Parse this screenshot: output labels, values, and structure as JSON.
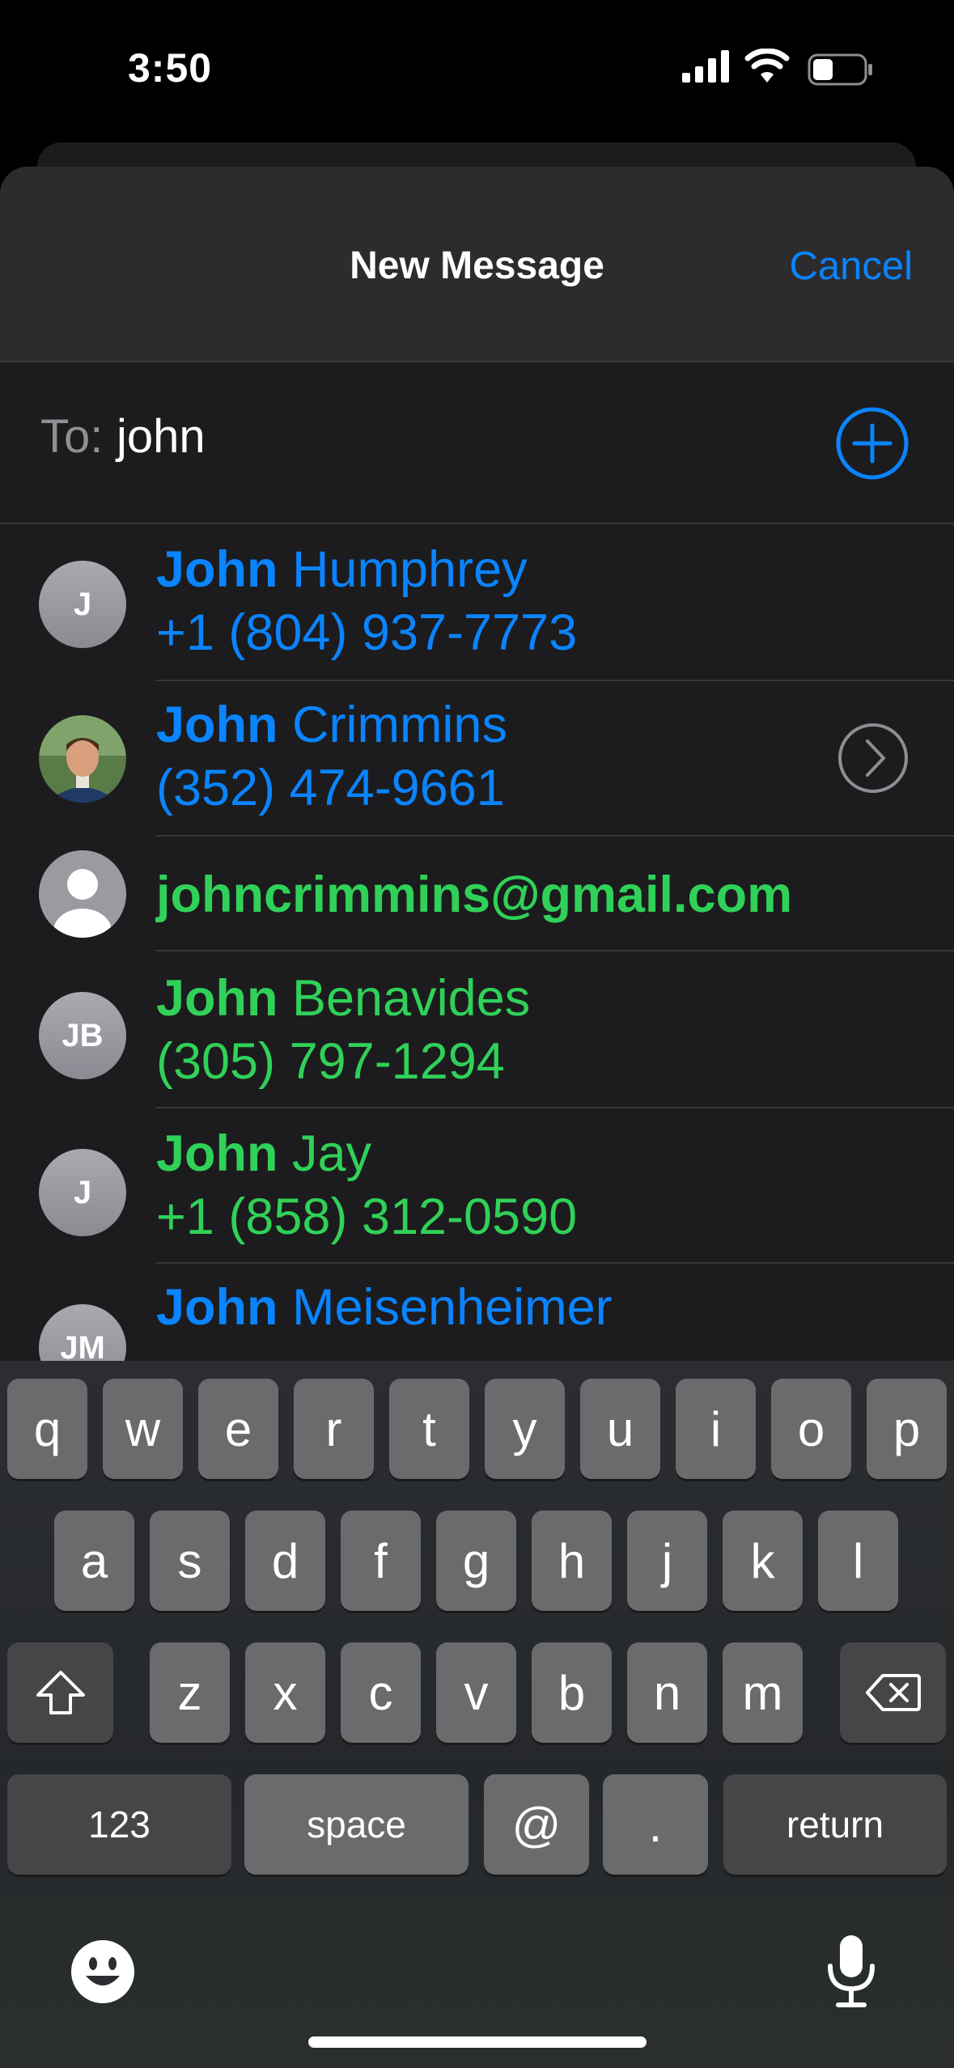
{
  "status_bar": {
    "time": "3:50"
  },
  "header": {
    "title": "New Message",
    "cancel_label": "Cancel"
  },
  "to_field": {
    "label": "To:",
    "value": "john"
  },
  "suggestions": [
    {
      "avatar_initials": "J",
      "first": "John",
      "last": " Humphrey",
      "detail": "+1 (804) 937-7773",
      "color": "#0a84ff"
    },
    {
      "avatar_type": "photo",
      "first": "John",
      "last": " Crimmins",
      "detail": "(352) 474-9661",
      "color": "#0a84ff"
    },
    {
      "avatar_type": "person-icon",
      "email": "johncrimmins@gmail.com",
      "color": "#30d158"
    },
    {
      "avatar_initials": "JB",
      "first": "John",
      "last": " Benavides",
      "detail": "(305) 797-1294",
      "color": "#30d158"
    },
    {
      "avatar_initials": "J",
      "first": "John",
      "last": " Jay",
      "detail": "+1 (858) 312-0590",
      "color": "#30d158"
    },
    {
      "avatar_initials": "JM",
      "first": "John",
      "last": " Meisenheimer",
      "color": "#0a84ff"
    }
  ],
  "keyboard": {
    "row1": [
      "q",
      "w",
      "e",
      "r",
      "t",
      "y",
      "u",
      "i",
      "o",
      "p"
    ],
    "row2": [
      "a",
      "s",
      "d",
      "f",
      "g",
      "h",
      "j",
      "k",
      "l"
    ],
    "row3": [
      "z",
      "x",
      "c",
      "v",
      "b",
      "n",
      "m"
    ],
    "numbers_label": "123",
    "space_label": "space",
    "at_label": "@",
    "dot_label": ".",
    "return_label": "return"
  }
}
